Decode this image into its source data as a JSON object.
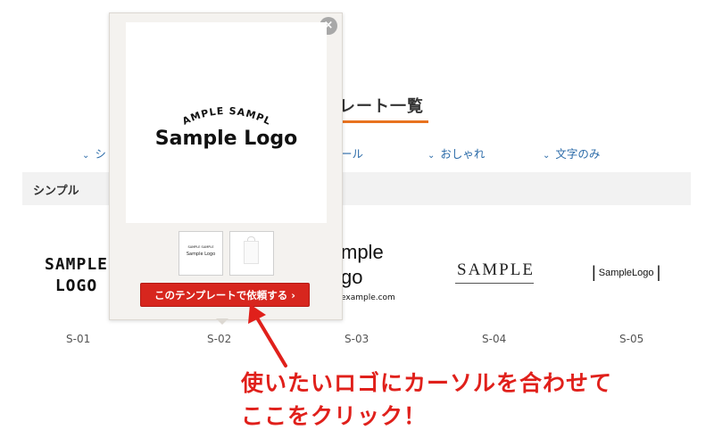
{
  "page": {
    "title": "レート一覧",
    "title_accent": "#e8731f"
  },
  "filters": [
    {
      "label": "シ"
    },
    {
      "label": "ール"
    },
    {
      "label": "おしゃれ"
    },
    {
      "label": "文字のみ"
    }
  ],
  "section": {
    "label": "シンプル"
  },
  "logos": {
    "s01": {
      "line1": "SAMPLE",
      "line2": "LOGO",
      "code": "S-01"
    },
    "s02": {
      "code": "S-02"
    },
    "s03": {
      "line1": "mple",
      "line2": "go",
      "line3": "example.com",
      "code": "S-03"
    },
    "s04": {
      "text": "SAMPLE",
      "code": "S-04"
    },
    "s05": {
      "text": "SampleLogo",
      "code": "S-05"
    }
  },
  "popup": {
    "close_icon": "×",
    "preview": {
      "arc_text": "SAMPLE SAMPLE",
      "main_text": "Sample Logo"
    },
    "thumb1": {
      "arc_text": "SAMPLE SAMPLE",
      "main_text": "Sample Logo"
    },
    "order_button": "このテンプレートで依頼する ›",
    "button_color": "#d7261e"
  },
  "annotation": {
    "line1": "使いたいロゴにカーソルを合わせて",
    "line2": "ここをクリック！",
    "color": "#e0201b"
  }
}
